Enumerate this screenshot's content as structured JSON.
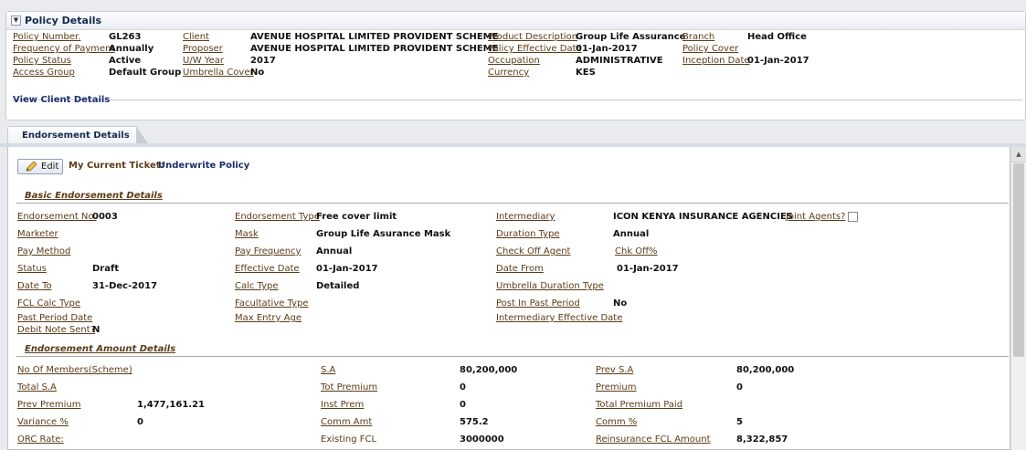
{
  "policy_panel": {
    "title": "Policy Details",
    "fields": [
      {
        "label": "Policy Number.",
        "value": "GL263"
      },
      {
        "label": "Frequency of Payment",
        "value": "Annually"
      },
      {
        "label": "Policy Status",
        "value": "Active"
      },
      {
        "label": "Access Group",
        "value": "Default Group"
      },
      {
        "label": "Client",
        "value": "AVENUE HOSPITAL LIMITED PROVIDENT SCHEME"
      },
      {
        "label": "Proposer",
        "value": "AVENUE HOSPITAL LIMITED PROVIDENT SCHEME"
      },
      {
        "label": "U/W Year",
        "value": "2017"
      },
      {
        "label": "Umbrella Cover",
        "value": "No"
      },
      {
        "label": "Product Description",
        "value": "Group Life Assurance"
      },
      {
        "label": "Policy Effective Date",
        "value": "01-Jan-2017"
      },
      {
        "label": "Occupation",
        "value": "ADMINISTRATIVE"
      },
      {
        "label": "Currency",
        "value": "KES"
      },
      {
        "label": "Branch",
        "value": "Head Office"
      },
      {
        "label": "Policy Cover",
        "value": ""
      },
      {
        "label": "Inception Date",
        "value": "01-Jan-2017"
      }
    ],
    "view_client_link": "View Client Details"
  },
  "tabs": [
    {
      "label": "Endorsement Details"
    }
  ],
  "toolbar": {
    "edit_label": "Edit",
    "ticket_label": "My Current Ticket:",
    "ticket_value": "Underwrite Policy"
  },
  "basic_section": {
    "title": "Basic Endorsement Details",
    "fields": [
      {
        "label": "Endorsement No.",
        "value": "0003"
      },
      {
        "label": "Marketer",
        "value": ""
      },
      {
        "label": "Pay Method",
        "value": ""
      },
      {
        "label": "Status",
        "value": "Draft"
      },
      {
        "label": "Date To",
        "value": "31-Dec-2017"
      },
      {
        "label": "FCL Calc Type",
        "value": ""
      },
      {
        "label": "Past Period Date",
        "value": ""
      },
      {
        "label": "Debit Note Sent?",
        "value": "N"
      },
      {
        "label": "Endorsement Type",
        "value": "Free cover limit"
      },
      {
        "label": "Mask",
        "value": "Group Life Asurance Mask"
      },
      {
        "label": "Pay Frequency",
        "value": "Annual"
      },
      {
        "label": "Effective Date",
        "value": "01-Jan-2017"
      },
      {
        "label": "Calc Type",
        "value": "Detailed"
      },
      {
        "label": "Facultative Type",
        "value": ""
      },
      {
        "label": "Max Entry Age",
        "value": ""
      },
      {
        "label": "Intermediary",
        "value": "ICON KENYA INSURANCE AGENCIES"
      },
      {
        "label": "Duration Type",
        "value": "Annual"
      },
      {
        "label": "Check Off Agent",
        "value": ""
      },
      {
        "label": "Date From",
        "value": "01-Jan-2017"
      },
      {
        "label": "Umbrella Duration Type",
        "value": ""
      },
      {
        "label": "Post In Past Period",
        "value": "No"
      },
      {
        "label": "Intermediary Effective Date",
        "value": ""
      }
    ],
    "joint_agents_label": "Joint Agents?",
    "chk_off_label": "Chk Off%"
  },
  "amount_section": {
    "title": "Endorsement Amount Details",
    "fields": [
      {
        "label": "No Of Members(Scheme)",
        "value": ""
      },
      {
        "label": "Total S.A",
        "value": ""
      },
      {
        "label": "Prev Premium",
        "value": "1,477,161.21"
      },
      {
        "label": "Variance %",
        "value": "0"
      },
      {
        "label": "ORC Rate:",
        "value": ""
      },
      {
        "label": "S.A",
        "value": "80,200,000"
      },
      {
        "label": "Tot Premium",
        "value": "0"
      },
      {
        "label": "Inst Prem",
        "value": "0"
      },
      {
        "label": "Comm Amt",
        "value": "575.2"
      },
      {
        "label": "Existing FCL",
        "value": "3000000"
      },
      {
        "label": "Prev S.A",
        "value": "80,200,000"
      },
      {
        "label": "Premium",
        "value": "0"
      },
      {
        "label": "Total Premium Paid",
        "value": ""
      },
      {
        "label": "Comm %",
        "value": "5"
      },
      {
        "label": "Reinsurance FCL Amount",
        "value": "8,322,857"
      }
    ]
  }
}
